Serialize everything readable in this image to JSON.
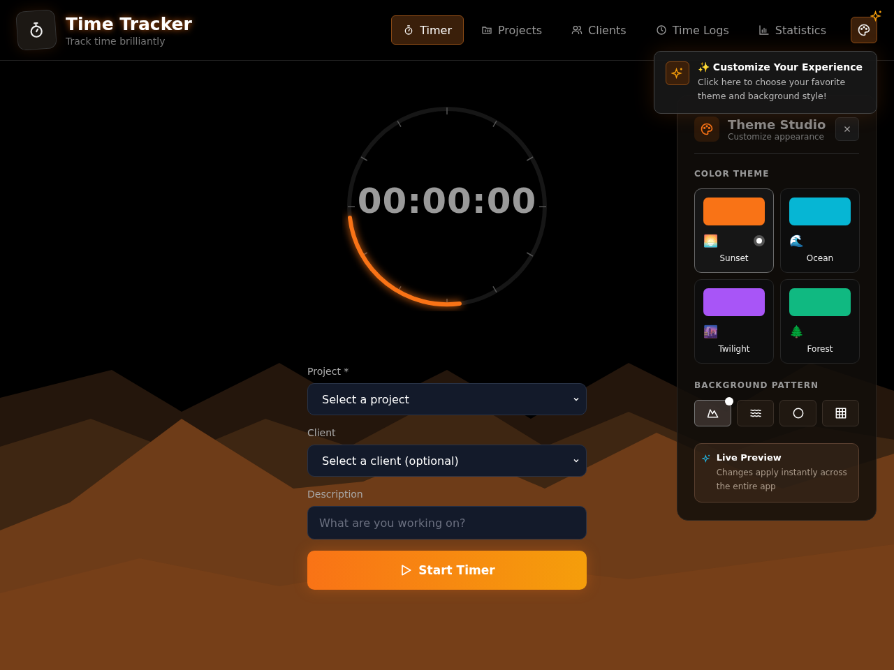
{
  "app": {
    "title": "Time Tracker",
    "subtitle": "Track time brilliantly"
  },
  "nav": [
    {
      "label": "Timer",
      "selected": true
    },
    {
      "label": "Projects",
      "selected": false
    },
    {
      "label": "Clients",
      "selected": false
    },
    {
      "label": "Time Logs",
      "selected": false
    },
    {
      "label": "Statistics",
      "selected": false
    }
  ],
  "timer": {
    "display": "00:00:00"
  },
  "form": {
    "fields": [
      {
        "kind": "select",
        "label": "Project *",
        "value": "Select a project"
      },
      {
        "kind": "select",
        "label": "Client",
        "value": "Select a client (optional)"
      },
      {
        "kind": "input",
        "label": "Description",
        "placeholder": "What are you working on?"
      }
    ],
    "start_button": "Start Timer"
  },
  "tooltip": {
    "title": "✨ Customize Your Experience",
    "text": "Click here to choose your favorite theme and background style!"
  },
  "theme_studio": {
    "title": "Theme Studio",
    "subtitle": "Customize appearance",
    "color_theme_heading": "COLOR THEME",
    "themes": [
      {
        "name": "Sunset",
        "emoji": "🌅",
        "color": "#f97316",
        "selected": true
      },
      {
        "name": "Ocean",
        "emoji": "🌊",
        "color": "#06b6d4",
        "selected": false
      },
      {
        "name": "Twilight",
        "emoji": "🌆",
        "color": "#a855f7",
        "selected": false
      },
      {
        "name": "Forest",
        "emoji": "🌲",
        "color": "#10b981",
        "selected": false
      }
    ],
    "pattern_heading": "BACKGROUND PATTERN",
    "patterns": [
      {
        "kind": "mountains",
        "selected": true
      },
      {
        "kind": "waves",
        "selected": false
      },
      {
        "kind": "circle",
        "selected": false
      },
      {
        "kind": "grid",
        "selected": false
      }
    ],
    "preview": {
      "title": "Live Preview",
      "text": "Changes apply instantly across the entire app"
    }
  }
}
